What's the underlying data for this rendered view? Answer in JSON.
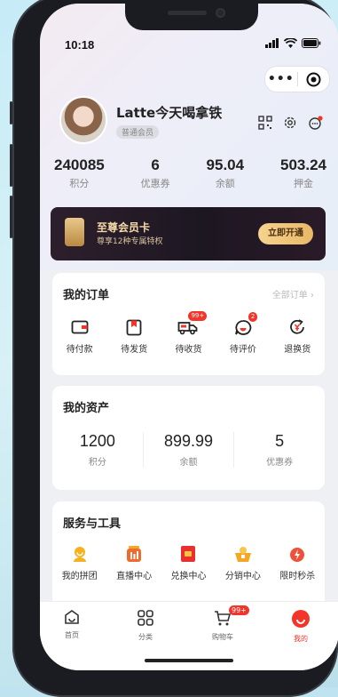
{
  "status_bar": {
    "time": "10:18"
  },
  "capsule": {
    "more": "•••"
  },
  "profile": {
    "name": "Latte今天喝拿铁",
    "level_badge": "普通会员"
  },
  "stats": [
    {
      "value": "240085",
      "label": "积分"
    },
    {
      "value": "6",
      "label": "优惠券"
    },
    {
      "value": "95.04",
      "label": "余额"
    },
    {
      "value": "503.24",
      "label": "押金"
    }
  ],
  "vip_banner": {
    "title": "至尊会员卡",
    "subtitle": "尊享12种专属特权",
    "button": "立即开通"
  },
  "orders": {
    "title": "我的订单",
    "all_link": "全部订单 ›",
    "items": [
      {
        "label": "待付款",
        "icon": "wallet-icon"
      },
      {
        "label": "待发货",
        "icon": "package-icon"
      },
      {
        "label": "待收货",
        "icon": "truck-icon",
        "badge": "99+"
      },
      {
        "label": "待评价",
        "icon": "comment-icon",
        "badge": "2"
      },
      {
        "label": "退换货",
        "icon": "refund-icon"
      }
    ]
  },
  "assets": {
    "title": "我的资产",
    "items": [
      {
        "value": "1200",
        "label": "积分"
      },
      {
        "value": "899.99",
        "label": "余额"
      },
      {
        "value": "5",
        "label": "优惠券"
      }
    ]
  },
  "services": {
    "title": "服务与工具",
    "items": [
      {
        "label": "我的拼团",
        "icon": "group-buy-icon",
        "color": "#f5b21c"
      },
      {
        "label": "直播中心",
        "icon": "live-icon",
        "color": "#f06a2b"
      },
      {
        "label": "兑换中心",
        "icon": "exchange-icon",
        "color": "#e8312f"
      },
      {
        "label": "分销中心",
        "icon": "distribution-icon",
        "color": "#f5a623"
      },
      {
        "label": "限时秒杀",
        "icon": "flash-sale-icon",
        "color": "#f0503a"
      }
    ]
  },
  "tabbar": {
    "items": [
      {
        "label": "首页",
        "icon": "home-icon"
      },
      {
        "label": "分类",
        "icon": "category-icon"
      },
      {
        "label": "购物车",
        "icon": "cart-icon",
        "badge": "99+"
      },
      {
        "label": "我的",
        "icon": "profile-icon",
        "active": true
      }
    ]
  },
  "colors": {
    "accent": "#f2342a",
    "vip_gold": "#f4d9a6",
    "vip_bg": "#1d1722"
  }
}
